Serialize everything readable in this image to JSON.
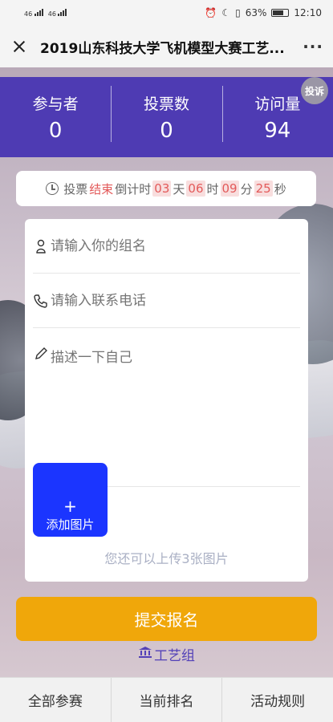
{
  "status_bar": {
    "signal1": "46",
    "signal2": "46",
    "battery": "63%",
    "time": "12:10"
  },
  "title_bar": {
    "title": "2019山东科技大学飞机模型大赛工艺..."
  },
  "stats": [
    {
      "label": "参与者",
      "value": "0"
    },
    {
      "label": "投票数",
      "value": "0"
    },
    {
      "label": "访问量",
      "value": "94"
    }
  ],
  "complain": "投诉",
  "countdown": {
    "prefix": "投票",
    "status": "结束",
    "text": "倒计时",
    "days": "03",
    "days_unit": "天",
    "hours": "06",
    "hours_unit": "时",
    "minutes": "09",
    "minutes_unit": "分",
    "seconds": "25",
    "seconds_unit": "秒"
  },
  "form": {
    "group_placeholder": "请输入你的组名",
    "phone_placeholder": "请输入联系电话",
    "desc_placeholder": "描述一下自己",
    "add_photo_plus": "+",
    "add_photo_label": "添加图片",
    "upload_hint": "您还可以上传3张图片"
  },
  "submit_label": "提交报名",
  "group_link": "工艺组",
  "bottom_nav": [
    {
      "label": "全部参赛"
    },
    {
      "label": "当前排名"
    },
    {
      "label": "活动规则"
    }
  ],
  "colors": {
    "stats_bg": "#4e3bb3",
    "submit_bg": "#f0a70a",
    "add_photo_bg": "#1b35ff",
    "countdown_accent": "#e35a5a"
  }
}
